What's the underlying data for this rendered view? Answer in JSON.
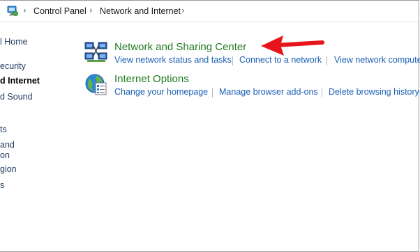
{
  "breadcrumb": {
    "icon": "control-panel-icon",
    "items": [
      "Control Panel",
      "Network and Internet"
    ]
  },
  "leftnav": {
    "items": [
      {
        "label": "l Home",
        "bold": false
      },
      {
        "label": "ecurity",
        "bold": false
      },
      {
        "label": "d Internet",
        "bold": true
      },
      {
        "label": "d Sound",
        "bold": false
      },
      {
        "label": "ts",
        "bold": false
      },
      {
        "label": "and",
        "bold": false
      },
      {
        "label": "on",
        "bold": false
      },
      {
        "label": "gion",
        "bold": false
      },
      {
        "label": "s",
        "bold": false
      }
    ]
  },
  "categories": [
    {
      "title": "Network and Sharing Center",
      "icon": "network-sharing-icon",
      "links": [
        "View network status and tasks",
        "Connect to a network",
        "View network compute"
      ]
    },
    {
      "title": "Internet Options",
      "icon": "internet-options-icon",
      "links": [
        "Change your homepage",
        "Manage browser add-ons",
        "Delete browsing history a"
      ]
    }
  ],
  "annotation": {
    "icon": "red-arrow-icon",
    "color": "#e8141b"
  },
  "colors": {
    "title_green": "#1e7a1e",
    "link_blue": "#1a5fb4",
    "nav_text": "#1e395b"
  }
}
